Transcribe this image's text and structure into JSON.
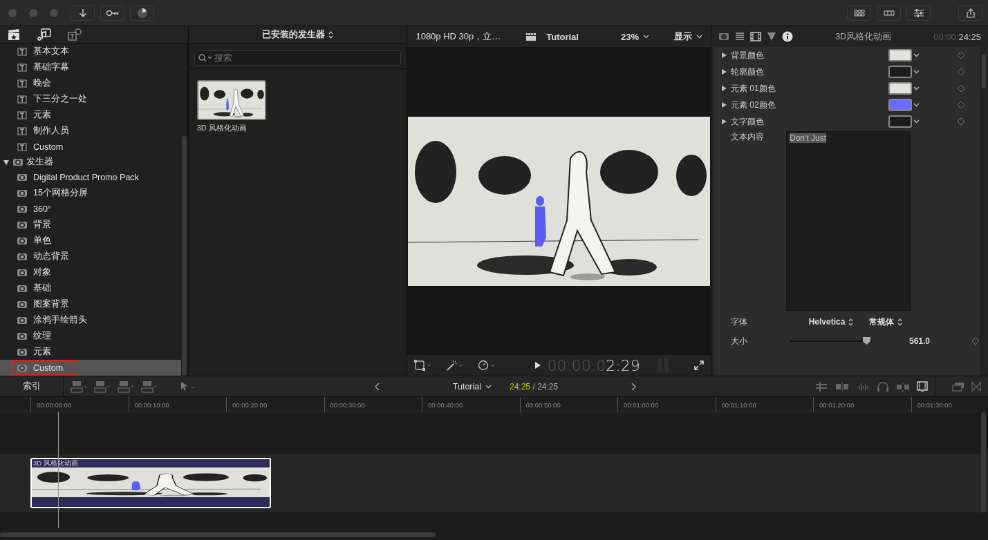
{
  "browser": {
    "title": "已安装的发生器",
    "search_placeholder": "搜索",
    "items": [
      {
        "label": "3D 风格化动画",
        "kind": "picture"
      }
    ]
  },
  "sidebar": {
    "items": [
      {
        "kind": "titles",
        "children": [
          {
            "label": "基本文本",
            "selected": false
          },
          {
            "label": "基础字幕",
            "selected": false
          },
          {
            "label": "晚会",
            "selected": false
          },
          {
            "label": "下三分之一处",
            "selected": false
          },
          {
            "label": "元素",
            "selected": false
          },
          {
            "label": "制作人员",
            "selected": false
          },
          {
            "label": "Custom",
            "selected": false
          }
        ]
      },
      {
        "kind": "generators",
        "label": "发生器",
        "expanded": true,
        "children": [
          {
            "label": "Digital Product Promo Pack",
            "selected": false
          },
          {
            "label": "15个网格分屏",
            "selected": false
          },
          {
            "label": "360°",
            "selected": false
          },
          {
            "label": "背景",
            "selected": false
          },
          {
            "label": "单色",
            "selected": false
          },
          {
            "label": "动态背景",
            "selected": false
          },
          {
            "label": "对象",
            "selected": false
          },
          {
            "label": "基础",
            "selected": false
          },
          {
            "label": "图案背景",
            "selected": false
          },
          {
            "label": "涂鸦手绘箭头",
            "selected": false
          },
          {
            "label": "纹理",
            "selected": false
          },
          {
            "label": "元素",
            "selected": false
          },
          {
            "label": "Custom",
            "selected": true
          }
        ]
      }
    ]
  },
  "viewer": {
    "format": "1080p HD 30p，立…",
    "project": "Tutorial",
    "zoom": "23%",
    "view_menu": "显示",
    "timecode_dim": "00:00:0",
    "timecode": "2:29"
  },
  "inspector": {
    "title": "3D风格化动画",
    "duration_dim": "00:00:",
    "duration": "24:25",
    "color_rows": [
      {
        "label": "背景颜色",
        "color": "#e2e2de"
      },
      {
        "label": "轮廓颜色",
        "color": "#1c1c1c"
      },
      {
        "label": "元素 01颜色",
        "color": "#e2e2de"
      },
      {
        "label": "元素 02颜色",
        "color": "#6b6bff"
      },
      {
        "label": "文字颜色",
        "color": "#1c1c1c"
      }
    ],
    "text_label": "文本内容",
    "text_value": "Don't Just",
    "font_label": "字体",
    "font": "Helvetica",
    "font_style": "常规体",
    "size_label": "大小",
    "size": {
      "level": 0.98
    },
    "size_value": "561.0"
  },
  "timeline": {
    "index_button": "索引",
    "project": "Tutorial",
    "position": "24:25",
    "duration": "/ 24:25",
    "ruler": [
      "00:00:00:00",
      "00:00:10:00",
      "00:00:20:00",
      "00:00:30:00",
      "00:00:40:00",
      "00:00:50:00",
      "00:01:00:00",
      "00:01:10:00",
      "00:01:20:00",
      "00:01:30:00"
    ],
    "clips": [
      {
        "label": "3D 风格化动画",
        "kind": "picture"
      }
    ]
  }
}
